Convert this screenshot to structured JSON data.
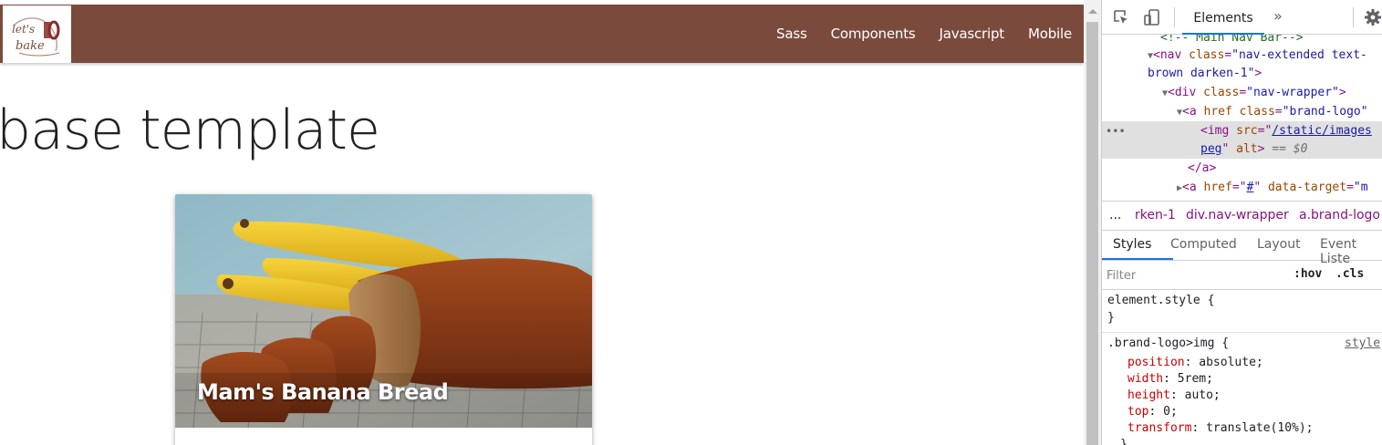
{
  "site": {
    "logo_text": "let's bake",
    "nav_links": [
      "Sass",
      "Components",
      "Javascript",
      "Mobile"
    ],
    "page_title": "base template",
    "card": {
      "title": "Mam's Banana Bread"
    }
  },
  "devtools": {
    "tabs": {
      "elements": "Elements",
      "more": "»"
    },
    "dom": {
      "comment": "<!-- Main Nav Bar-->",
      "nav_tag": "nav",
      "nav_class_attr": "class",
      "nav_class_val": "\"nav-extended text-",
      "nav_class_val2": "brown darken-1\"",
      "div_tag": "div",
      "div_class_val": "\"nav-wrapper\"",
      "a_tag": "a",
      "a_href": "href",
      "a_class_val": "\"brand-logo\"",
      "img_tag": "img",
      "img_src_attr": "src",
      "img_src_val": "/static/images",
      "img_src_val2": "peg",
      "img_alt_attr": "alt",
      "img_marker": "== $0",
      "a_close": "</a>",
      "a2_href_val": "#",
      "a2_target_attr": "data-target",
      "a2_target_val": "\"m"
    },
    "breadcrumb": [
      "...",
      "rken-1",
      "div.nav-wrapper",
      "a.brand-logo"
    ],
    "subtabs": [
      "Styles",
      "Computed",
      "Layout",
      "Event Liste"
    ],
    "filter": {
      "placeholder": "Filter",
      "hov": ":hov",
      "cls": ".cls"
    },
    "styles": {
      "element_style_open": "element.style {",
      "element_style_close": "}",
      "selector": ".brand-logo>img {",
      "source": "style",
      "props": [
        {
          "name": "position",
          "value": "absolute;"
        },
        {
          "name": "width",
          "value": "5rem;"
        },
        {
          "name": "height",
          "value": "auto;"
        },
        {
          "name": "top",
          "value": "0;"
        },
        {
          "name": "transform",
          "value": "translate(10%);"
        }
      ],
      "close": "}"
    }
  },
  "colors": {
    "navbar": "#7a4b3d",
    "accent": "#1a73e8"
  }
}
